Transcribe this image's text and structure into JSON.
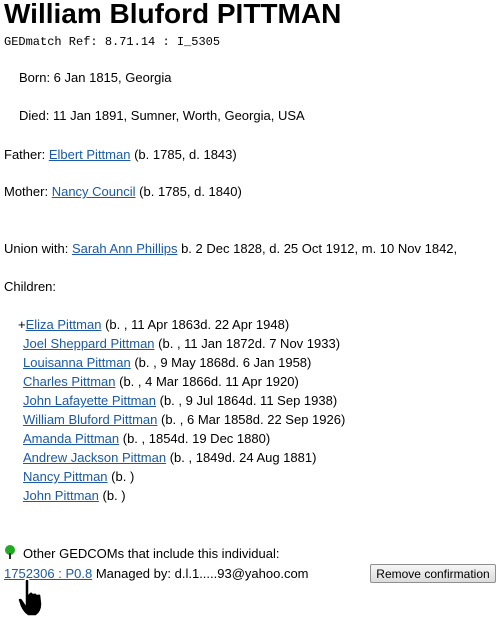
{
  "person": {
    "name": "William Bluford PITTMAN",
    "ref_label": "GEDmatch Ref:",
    "ref_value": "8.71.14 : I_5305",
    "born": "Born: 6 Jan 1815, Georgia",
    "died": "Died: 11 Jan 1891, Sumner, Worth, Georgia, USA"
  },
  "parents": {
    "father_label": "Father:",
    "father_name": "Elbert Pittman",
    "father_dates": "(b. 1785, d. 1843)",
    "mother_label": "Mother:",
    "mother_name": "Nancy Council",
    "mother_dates": "(b. 1785, d. 1840)"
  },
  "union": {
    "label": "Union with:",
    "spouse": "Sarah Ann Phillips",
    "details": "b. 2 Dec 1828, d. 25 Oct 1912, m. 10 Nov 1842,"
  },
  "children": {
    "label": "Children:",
    "items": [
      {
        "prefix": "+",
        "name": "Eliza Pittman",
        "dates": "(b. , 11 Apr 1863d. 22 Apr 1948)"
      },
      {
        "prefix": "",
        "name": "Joel Sheppard Pittman",
        "dates": "(b. , 11 Jan 1872d. 7 Nov 1933)"
      },
      {
        "prefix": "",
        "name": "Louisanna Pittman",
        "dates": "(b. , 9 May 1868d. 6 Jan 1958)"
      },
      {
        "prefix": "",
        "name": "Charles Pittman",
        "dates": "(b. , 4 Mar 1866d. 11 Apr 1920)"
      },
      {
        "prefix": "",
        "name": "John Lafayette Pittman",
        "dates": "(b. , 9 Jul 1864d. 11 Sep 1938)"
      },
      {
        "prefix": "",
        "name": "William Bluford Pittman",
        "dates": "(b. , 6 Mar 1858d. 22 Sep 1926)"
      },
      {
        "prefix": "",
        "name": "Amanda Pittman",
        "dates": "(b. , 1854d. 19 Dec 1880)"
      },
      {
        "prefix": "",
        "name": "Andrew Jackson Pittman",
        "dates": "(b. , 1849d. 24 Aug 1881)"
      },
      {
        "prefix": "",
        "name": "Nancy Pittman",
        "dates": "(b. )"
      },
      {
        "prefix": "",
        "name": "John Pittman",
        "dates": "(b. )"
      }
    ]
  },
  "gedcoms": {
    "icon": "tree-icon",
    "icon_color": "#22aa22",
    "label": "Other GEDCOMs that include this individual:",
    "ref_link": "1752306 : P0.8",
    "managed_label": "Managed by:",
    "managed_email": "d.l.1.....93@yahoo.com",
    "remove_button": "Remove confirmation"
  },
  "colors": {
    "link": "#1a5aa6"
  }
}
